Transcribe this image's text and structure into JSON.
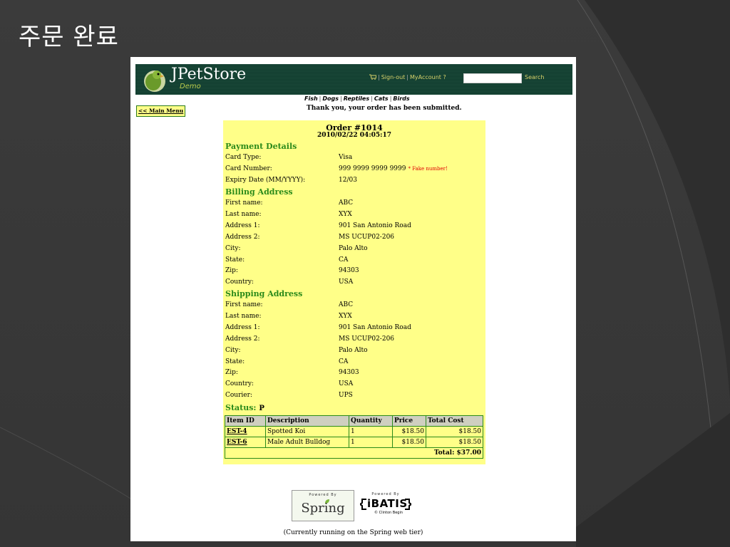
{
  "slide": {
    "title": "주문 완료"
  },
  "header": {
    "logo_title": "JPetStore",
    "logo_subtitle": "Demo",
    "sign_out": "Sign-out",
    "my_account": "MyAccount",
    "help": "?",
    "search_value": "",
    "search_label": "Search"
  },
  "quick_links": [
    "Fish",
    "Dogs",
    "Reptiles",
    "Cats",
    "Birds"
  ],
  "main_menu_label": "<< Main Menu",
  "confirmation": "Thank you, your order has been submitted.",
  "order": {
    "number": "Order #1014",
    "date": "2010/02/22 04:05:17",
    "payment": {
      "title": "Payment Details",
      "rows": [
        {
          "label": "Card Type:",
          "value": "Visa"
        },
        {
          "label": "Card Number:",
          "value": "999 9999 9999 9999",
          "note": "* Fake number!"
        },
        {
          "label": "Expiry Date (MM/YYYY):",
          "value": "12/03"
        }
      ]
    },
    "billing": {
      "title": "Billing Address",
      "rows": [
        {
          "label": "First name:",
          "value": "ABC"
        },
        {
          "label": "Last name:",
          "value": "XYX"
        },
        {
          "label": "Address 1:",
          "value": "901 San Antonio Road"
        },
        {
          "label": "Address 2:",
          "value": "MS UCUP02-206"
        },
        {
          "label": "City:",
          "value": "Palo Alto"
        },
        {
          "label": "State:",
          "value": "CA"
        },
        {
          "label": "Zip:",
          "value": "94303"
        },
        {
          "label": "Country:",
          "value": "USA"
        }
      ]
    },
    "shipping": {
      "title": "Shipping Address",
      "rows": [
        {
          "label": "First name:",
          "value": "ABC"
        },
        {
          "label": "Last name:",
          "value": "XYX"
        },
        {
          "label": "Address 1:",
          "value": "901 San Antonio Road"
        },
        {
          "label": "Address 2:",
          "value": "MS UCUP02-206"
        },
        {
          "label": "City:",
          "value": "Palo Alto"
        },
        {
          "label": "State:",
          "value": "CA"
        },
        {
          "label": "Zip:",
          "value": "94303"
        },
        {
          "label": "Country:",
          "value": "USA"
        },
        {
          "label": "Courier:",
          "value": "UPS"
        }
      ]
    },
    "status_label": "Status:",
    "status_value": "P",
    "table": {
      "headers": [
        "Item ID",
        "Description",
        "Quantity",
        "Price",
        "Total Cost"
      ],
      "rows": [
        [
          "EST-4",
          "Spotted Koi",
          "1",
          "$18.50",
          "$18.50"
        ],
        [
          "EST-6",
          "Male Adult Bulldog",
          "1",
          "$18.50",
          "$18.50"
        ]
      ],
      "total": "Total: $37.00"
    }
  },
  "powered": {
    "spring_small": "Powered By",
    "spring_word": "Spring",
    "ibatis_small": "Powered By",
    "ibatis_word": "iBATIS",
    "ibatis_sub": "© Clinton Begin"
  },
  "footer_note": "(Currently running on the Spring web tier)",
  "colors": {
    "header_green": "#0f3b2d",
    "panel_yellow": "#ffff88",
    "section_green": "#2b8a1a",
    "fake_red": "#e00000"
  }
}
